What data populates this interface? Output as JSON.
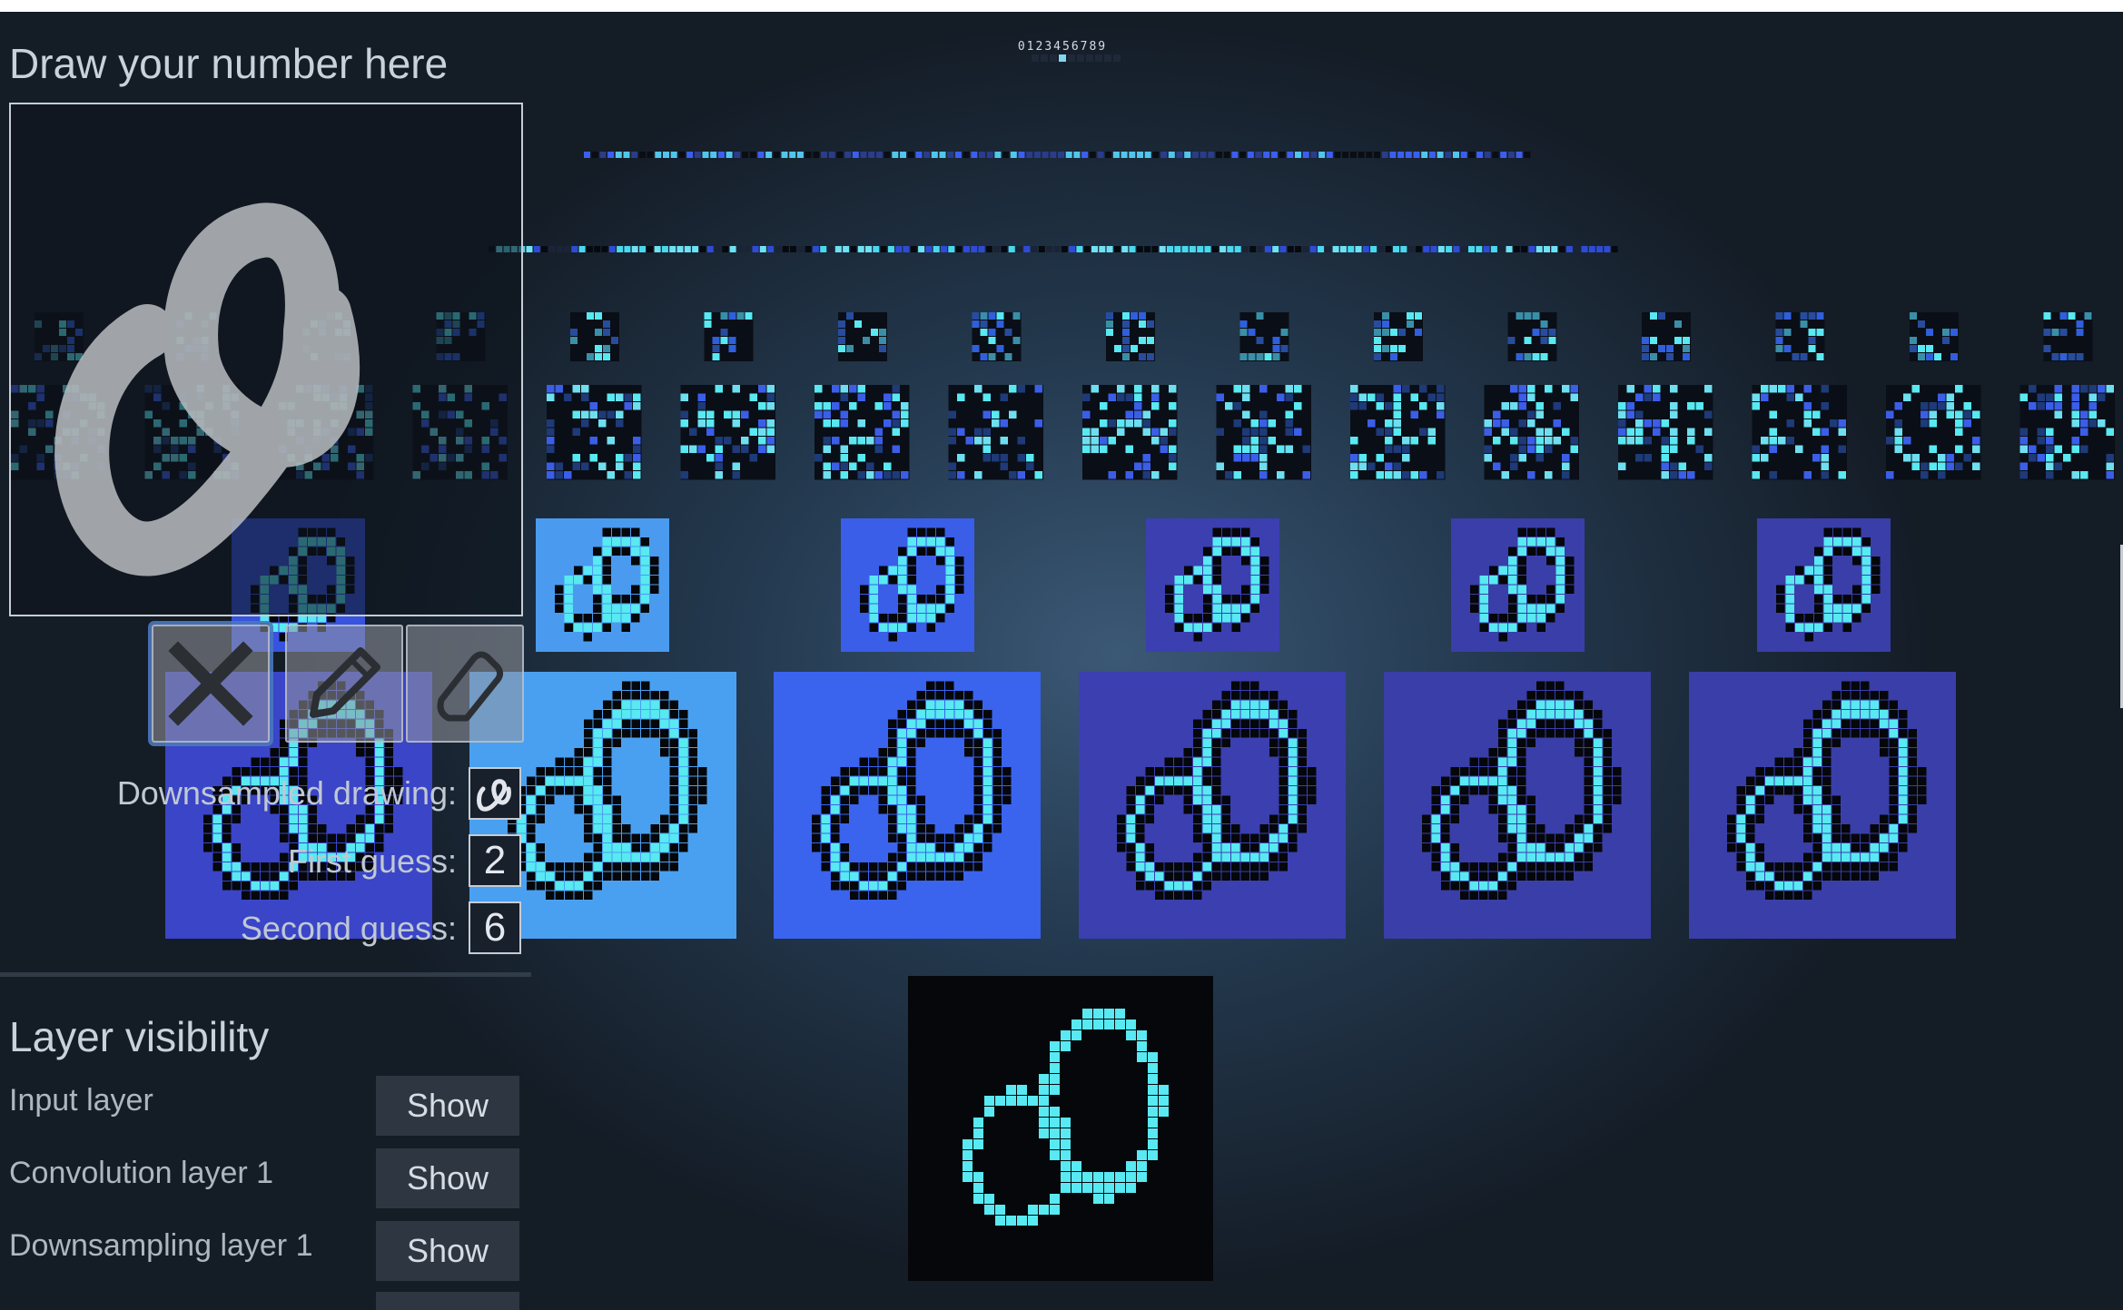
{
  "title": "Draw your number here",
  "digits_label": "0123456789",
  "tools": {
    "clear_label": "Clear",
    "pencil_label": "Pencil",
    "eraser_label": "Eraser"
  },
  "results": {
    "downsampled_label": "Downsampled drawing:",
    "first_guess_label": "First guess:",
    "first_guess_value": "2",
    "second_guess_label": "Second guess:",
    "second_guess_value": "6"
  },
  "layer_visibility": {
    "title": "Layer visibility",
    "layers": [
      {
        "label": "Input layer",
        "button": "Show"
      },
      {
        "label": "Convolution layer 1",
        "button": "Show"
      },
      {
        "label": "Downsampling layer 1",
        "button": "Show"
      }
    ]
  },
  "colors": {
    "cyan": "#58e9f2",
    "blue": "#4a6fe8",
    "black": "#05070a",
    "stroke": "#b4b8bc"
  }
}
